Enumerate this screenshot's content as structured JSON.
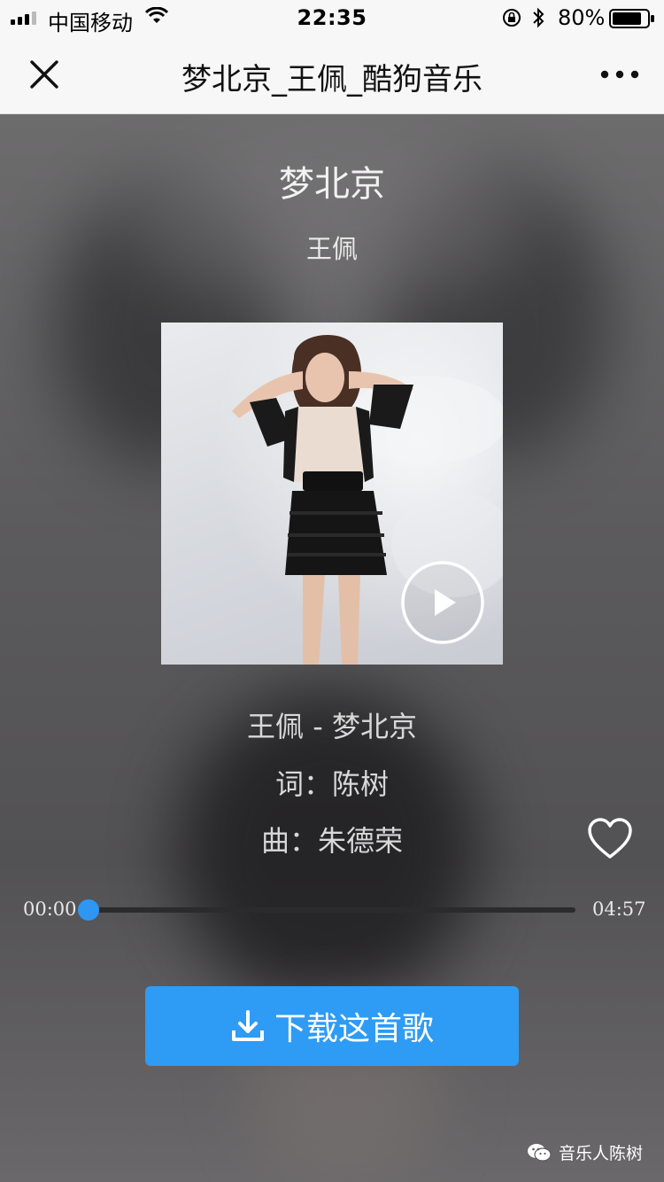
{
  "status_bar": {
    "carrier": "中国移动",
    "time": "22:35",
    "battery": "80%"
  },
  "nav": {
    "title": "梦北京_王佩_酷狗音乐"
  },
  "song": {
    "title": "梦北京",
    "artist": "王佩"
  },
  "lyrics": {
    "line1": "王佩 - 梦北京",
    "line2": "词：陈树",
    "line3": "曲：朱德荣"
  },
  "player": {
    "current_time": "00:00",
    "total_time": "04:57",
    "progress": 0.0
  },
  "download": {
    "label": "下载这首歌"
  },
  "watermark": {
    "label": "音乐人陈树"
  },
  "colors": {
    "accent": "#2e9bf4",
    "nav_bg": "#f7f7f7"
  },
  "icons": [
    "signal-icon",
    "wifi-icon",
    "lock-icon",
    "bluetooth-icon",
    "battery-icon",
    "close-icon",
    "more-icon",
    "play-icon",
    "heart-icon",
    "download-icon",
    "wechat-icon"
  ]
}
